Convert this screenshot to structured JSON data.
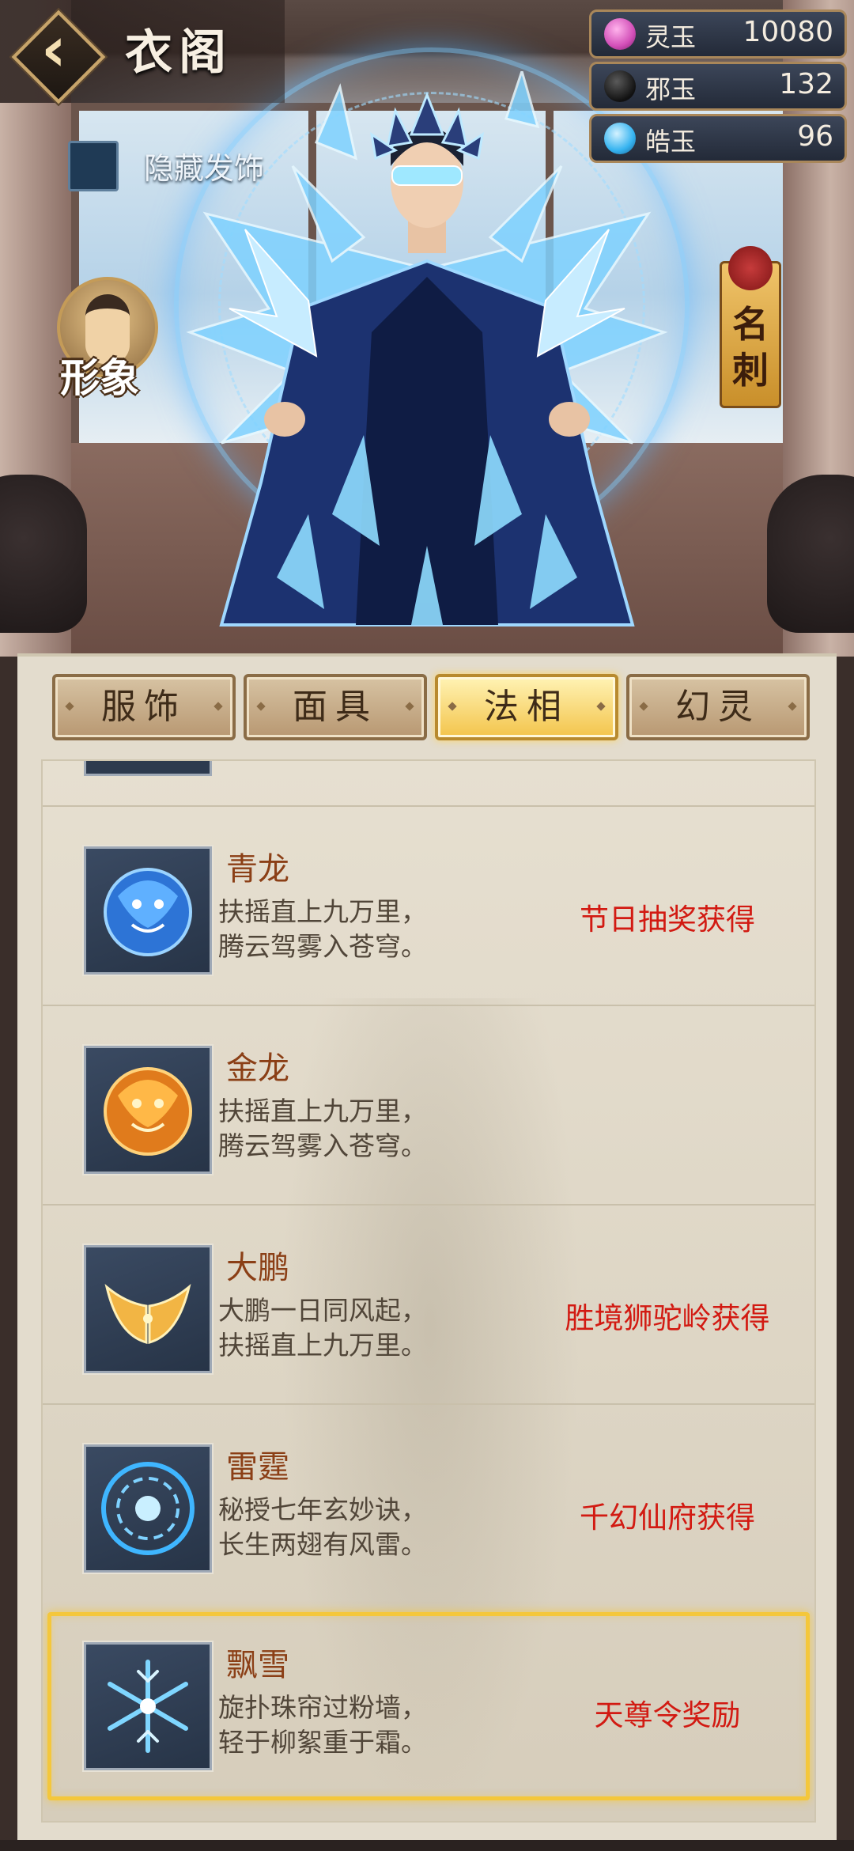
{
  "header": {
    "title": "衣阁",
    "hide_hair_label": "隐藏发饰",
    "hide_hair_checked": false
  },
  "currencies": [
    {
      "name": "灵玉",
      "value": "10080",
      "icon": "pink-jade-icon",
      "color": "#d24fb8"
    },
    {
      "name": "邪玉",
      "value": "132",
      "icon": "dark-swirl-icon",
      "color": "#1a1a1a"
    },
    {
      "name": "皓玉",
      "value": "96",
      "icon": "blue-drop-icon",
      "color": "#35b3f0"
    }
  ],
  "side_buttons": {
    "appearance_label": "形象",
    "card_label": "名刺"
  },
  "tabs": [
    {
      "label": "服饰",
      "active": false
    },
    {
      "label": "面具",
      "active": false
    },
    {
      "label": "法相",
      "active": true
    },
    {
      "label": "幻灵",
      "active": false
    }
  ],
  "items": [
    {
      "name": "青龙",
      "desc1": "扶摇直上九万里，",
      "desc2": "腾云驾雾入苍穹。",
      "source": "节日抽奖获得",
      "icon": "blue-dragon-icon",
      "selected": false
    },
    {
      "name": "金龙",
      "desc1": "扶摇直上九万里，",
      "desc2": "腾云驾雾入苍穹。",
      "source": "",
      "icon": "gold-dragon-icon",
      "selected": false
    },
    {
      "name": "大鹏",
      "desc1": "大鹏一日同风起，",
      "desc2": "扶摇直上九万里。",
      "source": "胜境狮驼岭获得",
      "icon": "golden-wings-icon",
      "selected": false
    },
    {
      "name": "雷霆",
      "desc1": "秘授七年玄妙诀，",
      "desc2": "长生两翅有风雷。",
      "source": "千幻仙府获得",
      "icon": "thunder-circle-icon",
      "selected": false
    },
    {
      "name": "飘雪",
      "desc1": "旋扑珠帘过粉墙，",
      "desc2": "轻于柳絮重于霜。",
      "source": "天尊令奖励",
      "icon": "snowflake-icon",
      "selected": true
    }
  ],
  "colors": {
    "accent_gold": "#f4c73b",
    "source_red": "#d21a12",
    "name_brown": "#8b3f16"
  }
}
